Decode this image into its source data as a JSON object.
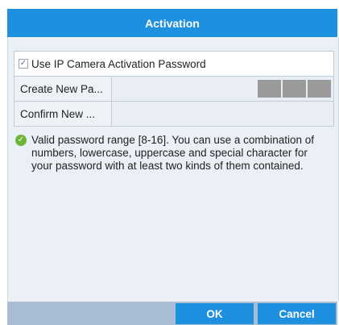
{
  "dialog": {
    "title": "Activation",
    "checkbox": {
      "checked": true,
      "label": "Use IP Camera Activation Password"
    },
    "fields": [
      {
        "label": "Create New Pa...",
        "value": ""
      },
      {
        "label": "Confirm New ...",
        "value": ""
      }
    ],
    "note": "Valid password range [8-16]. You can use a combination of numbers, lowercase, uppercase and special character for your password with at least two kinds of them contained.",
    "buttons": {
      "ok": "OK",
      "cancel": "Cancel"
    }
  },
  "icons": {
    "check": "checkmark-icon",
    "info": "ok-circle-icon"
  },
  "colors": {
    "accent": "#1f8fe0",
    "footer": "#a9bed2",
    "body": "#eaf0f5",
    "strength": "#9a9a9a",
    "ok_icon": "#6cb535"
  }
}
